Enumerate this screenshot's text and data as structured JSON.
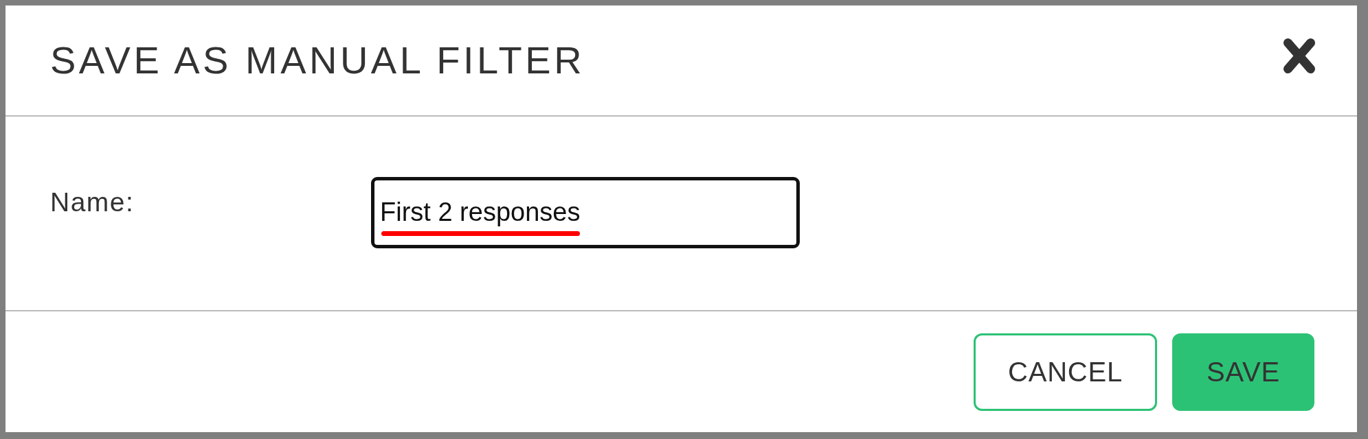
{
  "dialog": {
    "title": "SAVE AS MANUAL FILTER",
    "fields": [
      {
        "label": "Name:",
        "value": "First 2 responses",
        "underlined": true
      }
    ],
    "buttons": [
      {
        "label": "CANCEL",
        "kind": "secondary"
      },
      {
        "label": "SAVE",
        "kind": "primary"
      }
    ]
  }
}
